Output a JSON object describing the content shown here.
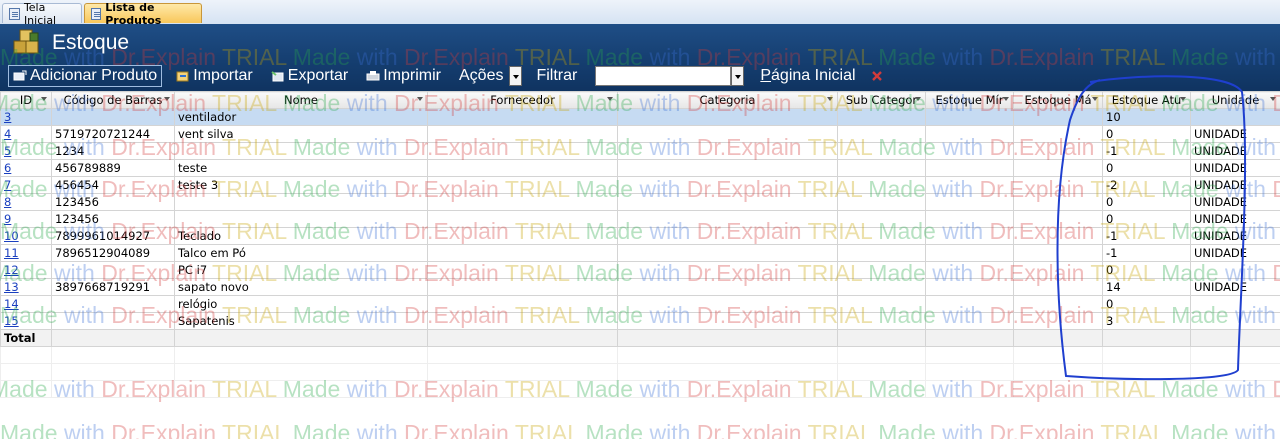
{
  "tabs": [
    {
      "label": "Tela Inicial",
      "active": false
    },
    {
      "label": "Lista de Produtos",
      "active": true
    }
  ],
  "header": {
    "title": "Estoque"
  },
  "toolbar": {
    "add_label": "Adicionar Produto",
    "import_label": "Importar",
    "export_label": "Exportar",
    "print_label": "Imprimir",
    "actions_label": "Ações",
    "filter_label": "Filtrar",
    "filter_value": "",
    "home_label": "Página Inicial"
  },
  "columns": [
    "ID",
    "Código de Barras",
    "Nome",
    "Fornecedor",
    "Categoria",
    "Sub Categor",
    "Estoque Mír",
    "Estoque Má",
    "Estoque Atu",
    "Unidade"
  ],
  "rows": [
    {
      "id": "3",
      "barcode": "",
      "name": "ventilador",
      "supplier": "",
      "category": "",
      "subcategory": "",
      "min": "",
      "max": "",
      "current": "10",
      "unit": ""
    },
    {
      "id": "4",
      "barcode": "5719720721244",
      "name": "vent silva",
      "supplier": "",
      "category": "",
      "subcategory": "",
      "min": "",
      "max": "",
      "current": "0",
      "unit": "UNIDADE"
    },
    {
      "id": "5",
      "barcode": "1234",
      "name": "",
      "supplier": "",
      "category": "",
      "subcategory": "",
      "min": "",
      "max": "",
      "current": "-1",
      "unit": "UNIDADE"
    },
    {
      "id": "6",
      "barcode": "456789889",
      "name": "teste",
      "supplier": "",
      "category": "",
      "subcategory": "",
      "min": "",
      "max": "",
      "current": "0",
      "unit": "UNIDADE"
    },
    {
      "id": "7",
      "barcode": "456454",
      "name": "teste 3",
      "supplier": "",
      "category": "",
      "subcategory": "",
      "min": "",
      "max": "",
      "current": "-2",
      "unit": "UNIDADE"
    },
    {
      "id": "8",
      "barcode": "123456",
      "name": "",
      "supplier": "",
      "category": "",
      "subcategory": "",
      "min": "",
      "max": "",
      "current": "0",
      "unit": "UNIDADE"
    },
    {
      "id": "9",
      "barcode": "123456",
      "name": "",
      "supplier": "",
      "category": "",
      "subcategory": "",
      "min": "",
      "max": "",
      "current": "0",
      "unit": "UNIDADE"
    },
    {
      "id": "10",
      "barcode": "7899961014927",
      "name": "Teclado",
      "supplier": "",
      "category": "",
      "subcategory": "",
      "min": "",
      "max": "",
      "current": "-1",
      "unit": "UNIDADE"
    },
    {
      "id": "11",
      "barcode": "7896512904089",
      "name": "Talco em Pó",
      "supplier": "",
      "category": "",
      "subcategory": "",
      "min": "",
      "max": "",
      "current": "-1",
      "unit": "UNIDADE"
    },
    {
      "id": "12",
      "barcode": "",
      "name": "PC i7",
      "supplier": "",
      "category": "",
      "subcategory": "",
      "min": "",
      "max": "",
      "current": "0",
      "unit": ""
    },
    {
      "id": "13",
      "barcode": "3897668719291",
      "name": "sapato novo",
      "supplier": "",
      "category": "",
      "subcategory": "",
      "min": "",
      "max": "",
      "current": "14",
      "unit": "UNIDADE"
    },
    {
      "id": "14",
      "barcode": "",
      "name": "relógio",
      "supplier": "",
      "category": "",
      "subcategory": "",
      "min": "",
      "max": "",
      "current": "0",
      "unit": ""
    },
    {
      "id": "15",
      "barcode": "",
      "name": "Sapatenis",
      "supplier": "",
      "category": "",
      "subcategory": "",
      "min": "",
      "max": "",
      "current": "3",
      "unit": ""
    }
  ],
  "total_label": "Total",
  "watermark": {
    "made": "Made",
    "with": "with",
    "brand": "Dr.Explain",
    "trial": "TRIAL"
  },
  "colors": {
    "header_bg": "#17406f",
    "active_tab": "#f8c75b",
    "selected_row": "#c6dbf2",
    "annotation_ink": "#1f3fcf",
    "link": "#1a3fbf"
  },
  "icons": [
    "product-stack-icon",
    "add-product-icon",
    "import-icon",
    "export-icon",
    "print-icon",
    "dropdown-arrow-icon",
    "close-x-icon",
    "sort-arrow-icon",
    "form-tab-icon"
  ]
}
